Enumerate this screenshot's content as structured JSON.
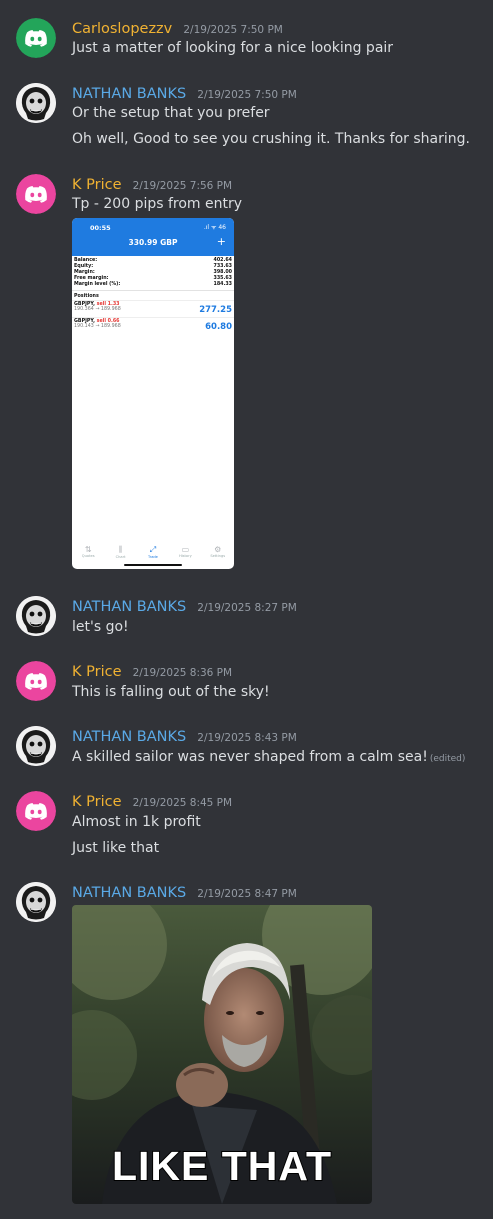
{
  "colors": {
    "background": "#313338",
    "text": "#dbdee1",
    "muted": "#949ba4",
    "author_orange": "#f0b232",
    "author_blue": "#5aa9e6",
    "avatar_green": "#23a55a",
    "avatar_pink": "#eb459f"
  },
  "messages": [
    {
      "author": "Carloslopezzv",
      "timestamp": "2/19/2025 7:50 PM",
      "avatar": "discord-logo-icon",
      "lines": [
        "Just a matter of looking for a nice looking pair"
      ]
    },
    {
      "author": "NATHAN BANKS",
      "timestamp": "2/19/2025 7:50 PM",
      "avatar": "skull-avatar",
      "lines": [
        "Or the setup that you prefer",
        "Oh well, Good to see you crushing it. Thanks for sharing."
      ]
    },
    {
      "author": "K Price",
      "timestamp": "2/19/2025 7:56 PM",
      "avatar": "discord-logo-icon",
      "lines": [
        "Tp - 200 pips from entry"
      ]
    },
    {
      "author": "NATHAN BANKS",
      "timestamp": "2/19/2025 8:27 PM",
      "avatar": "skull-avatar",
      "lines": [
        "let's go!"
      ]
    },
    {
      "author": "K Price",
      "timestamp": "2/19/2025 8:36 PM",
      "avatar": "discord-logo-icon",
      "lines": [
        "This is falling out of the sky!"
      ]
    },
    {
      "author": "NATHAN BANKS",
      "timestamp": "2/19/2025 8:43 PM",
      "avatar": "skull-avatar",
      "lines": [
        "A skilled sailor was never shaped from a calm sea!"
      ],
      "edited": "(edited)"
    },
    {
      "author": "K Price",
      "timestamp": "2/19/2025 8:45 PM",
      "avatar": "discord-logo-icon",
      "lines": [
        "Almost in 1k profit",
        "Just like that"
      ]
    },
    {
      "author": "NATHAN BANKS",
      "timestamp": "2/19/2025 8:47 PM",
      "avatar": "skull-avatar",
      "lines": []
    }
  ],
  "trade_screenshot": {
    "time": "00:55",
    "status": ".ıl ᯤ 46",
    "balance_header": "330.99 GBP",
    "plus": "+",
    "account": [
      {
        "label": "Balance:",
        "value": "402.64"
      },
      {
        "label": "Equity:",
        "value": "733.63"
      },
      {
        "label": "Margin:",
        "value": "398.00"
      },
      {
        "label": "Free margin:",
        "value": "335.63"
      },
      {
        "label": "Margin level (%):",
        "value": "184.33"
      }
    ],
    "positions_title": "Positions",
    "positions": [
      {
        "symbol": "GBPJPY,",
        "side": "sell 1.33",
        "prices": "190.364 → 189.968",
        "profit": "277.25"
      },
      {
        "symbol": "GBPJPY,",
        "side": "sell 0.66",
        "prices": "190.143 → 189.968",
        "profit": "60.80"
      }
    ],
    "nav": [
      "Quotes",
      "Chart",
      "Trade",
      "History",
      "Settings"
    ]
  },
  "gif": {
    "caption": "LIKE THAT"
  }
}
